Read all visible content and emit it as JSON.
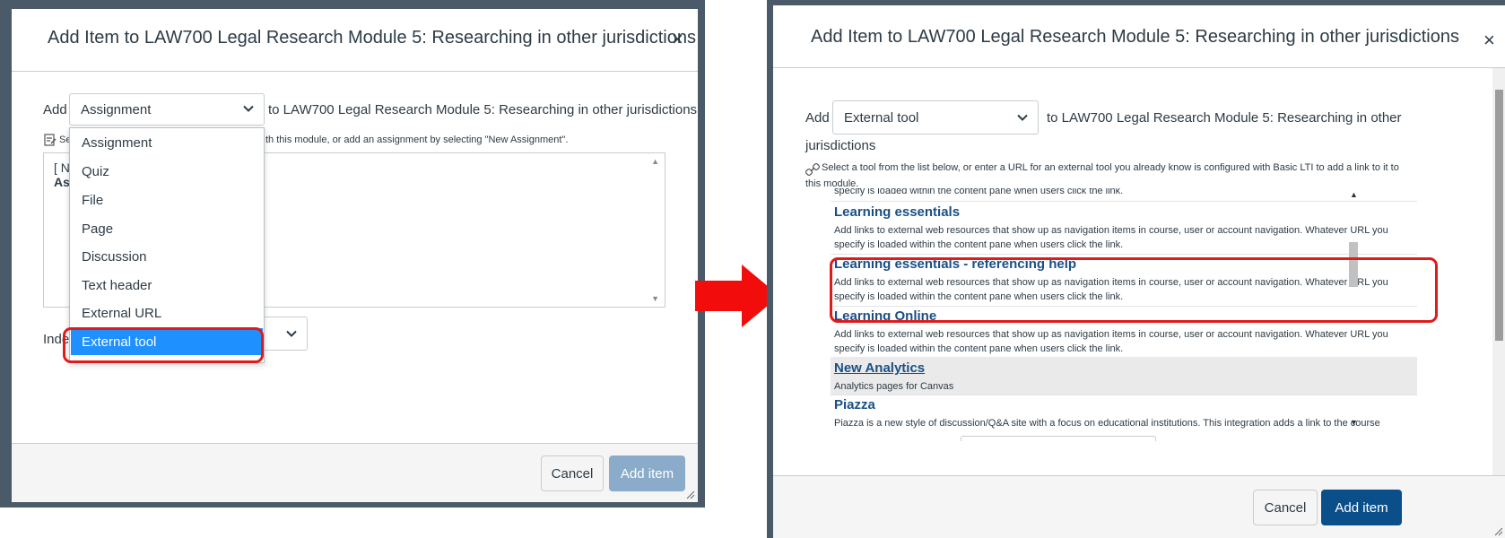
{
  "left_modal": {
    "title": "Add Item to LAW700 Legal Research Module 5: Researching in other jurisdictions",
    "add_label": "Add",
    "type_select_value": "Assignment",
    "to_text": "to LAW700 Legal Research Module 5: Researching in other jurisdictions",
    "hint_start": "Se",
    "hint_end": "th this module, or add an assignment by selecting \"New Assignment\".",
    "list_first_line": "[ N",
    "list_second_line": "As",
    "indent_label": "Inde",
    "dropdown_options": [
      "Assignment",
      "Quiz",
      "File",
      "Page",
      "Discussion",
      "Text header",
      "External URL",
      "External tool"
    ],
    "selected_option": "External tool",
    "cancel_label": "Cancel",
    "add_item_label": "Add item"
  },
  "right_modal": {
    "title": "Add Item to LAW700 Legal Research Module 5: Researching in other jurisdictions",
    "add_label": "Add",
    "type_select_value": "External tool",
    "to_text_line1": "to LAW700 Legal Research Module 5: Researching in other",
    "to_text_line2": "jurisdictions",
    "hint_line1": "Select a tool from the list below, or enter a URL for an external tool you already know is configured with Basic LTI to add a link to it to",
    "hint_line2": "this module.",
    "cut_line": "specify is loaded within the content pane when users click the link.",
    "tools": [
      {
        "name": "Learning essentials",
        "desc1": "Add links to external web resources that show up as navigation items in course, user or account navigation. Whatever URL you",
        "desc2": "specify is loaded within the content pane when users click the link."
      },
      {
        "name": "Learning essentials - referencing help",
        "desc1": "Add links to external web resources that show up as navigation items in course, user or account navigation. Whatever URL you",
        "desc2": "specify is loaded within the content pane when users click the link."
      },
      {
        "name": "Learning Online",
        "desc1": "Add links to external web resources that show up as navigation items in course, user or account navigation. Whatever URL you",
        "desc2": "specify is loaded within the content pane when users click the link."
      },
      {
        "name": "New Analytics",
        "desc1": "Analytics pages for Canvas",
        "desc2": ""
      },
      {
        "name": "Piazza",
        "desc1": "Piazza is a new style of discussion/Q&A site with a focus on educational institutions. This integration adds a link to the course",
        "desc2": ""
      }
    ],
    "cancel_label": "Cancel",
    "add_item_label": "Add item"
  },
  "colors": {
    "annotation_red": "#e01b1b",
    "selected_blue": "#1e90ff",
    "link_blue": "#1a4f86",
    "primary_button": "#0b4f8a",
    "disabled_button": "#8aabc9"
  }
}
